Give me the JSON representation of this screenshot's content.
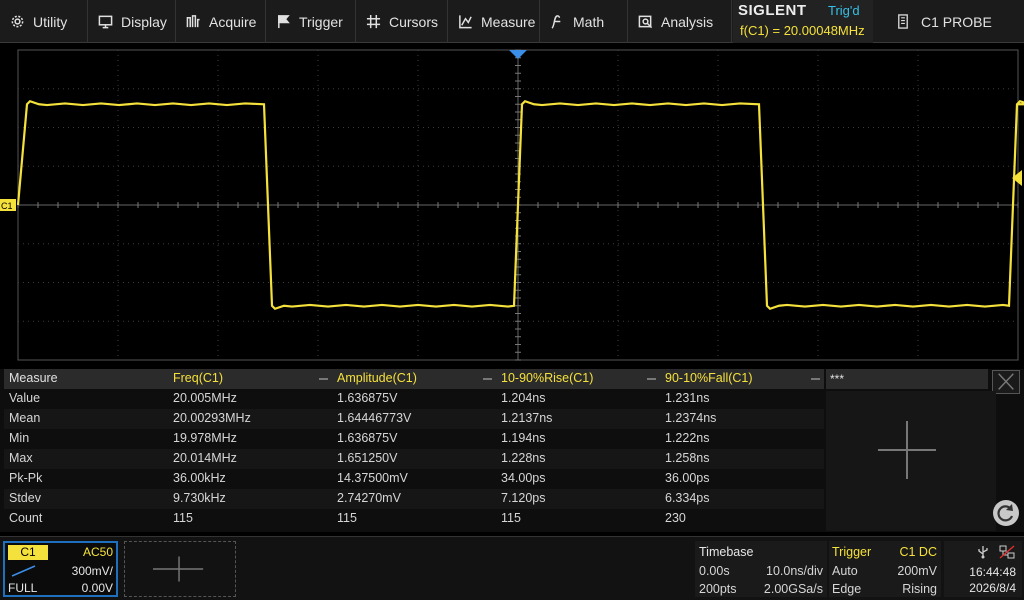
{
  "menu": [
    {
      "label": "Utility",
      "icon": "gear-icon"
    },
    {
      "label": "Display",
      "icon": "monitor-icon"
    },
    {
      "label": "Acquire",
      "icon": "acquire-icon"
    },
    {
      "label": "Trigger",
      "icon": "flag-icon"
    },
    {
      "label": "Cursors",
      "icon": "cursors-icon"
    },
    {
      "label": "Measure",
      "icon": "measure-icon"
    },
    {
      "label": "Math",
      "icon": "math-icon"
    },
    {
      "label": "Analysis",
      "icon": "analysis-icon"
    }
  ],
  "brand": "SIGLENT",
  "trigger_status": "Trig'd",
  "freq_readout": "f(C1) = 20.00048MHz",
  "probe": "C1 PROBE",
  "channel_marker": "C1",
  "waveform": {
    "color": "#f5e13b",
    "high_level_div": 2.6,
    "low_level_div": -2.6,
    "edges": [
      {
        "type": "rise",
        "div": -4.95
      },
      {
        "type": "fall",
        "div": -2.5
      },
      {
        "type": "rise",
        "div": 0.0
      },
      {
        "type": "fall",
        "div": 2.45
      },
      {
        "type": "rise",
        "div": 4.95
      }
    ]
  },
  "measure": {
    "header": [
      "Measure",
      "Freq(C1)",
      "Amplitude(C1)",
      "10-90%Rise(C1)",
      "90-10%Fall(C1)"
    ],
    "extra_header": "***",
    "rows": [
      [
        "Value",
        "20.005MHz",
        "1.636875V",
        "1.204ns",
        "1.231ns"
      ],
      [
        "Mean",
        "20.00293MHz",
        "1.64446773V",
        "1.2137ns",
        "1.2374ns"
      ],
      [
        "Min",
        "19.978MHz",
        "1.636875V",
        "1.194ns",
        "1.222ns"
      ],
      [
        "Max",
        "20.014MHz",
        "1.651250V",
        "1.228ns",
        "1.258ns"
      ],
      [
        "Pk-Pk",
        "36.00kHz",
        "14.37500mV",
        "34.00ps",
        "36.00ps"
      ],
      [
        "Stdev",
        "9.730kHz",
        "2.74270mV",
        "7.120ps",
        "6.334ps"
      ],
      [
        "Count",
        "115",
        "115",
        "115",
        "230"
      ]
    ]
  },
  "channel": {
    "name": "C1",
    "coupling": "AC50",
    "scale": "300mV/",
    "bandwidth": "FULL",
    "offset": "0.00V"
  },
  "timebase": {
    "title": "Timebase",
    "delay": "0.00s",
    "scale": "10.0ns/div",
    "points": "200pts",
    "rate": "2.00GSa/s"
  },
  "trigger": {
    "title": "Trigger",
    "source": "C1 DC",
    "mode": "Auto",
    "level": "200mV",
    "type": "Edge",
    "slope": "Rising"
  },
  "clock": {
    "time": "16:44:48",
    "date": "2026/8/4"
  },
  "colors": {
    "accent": "#f5e13b",
    "status": "#36c0e6",
    "channel_border": "#1f6fbf"
  }
}
